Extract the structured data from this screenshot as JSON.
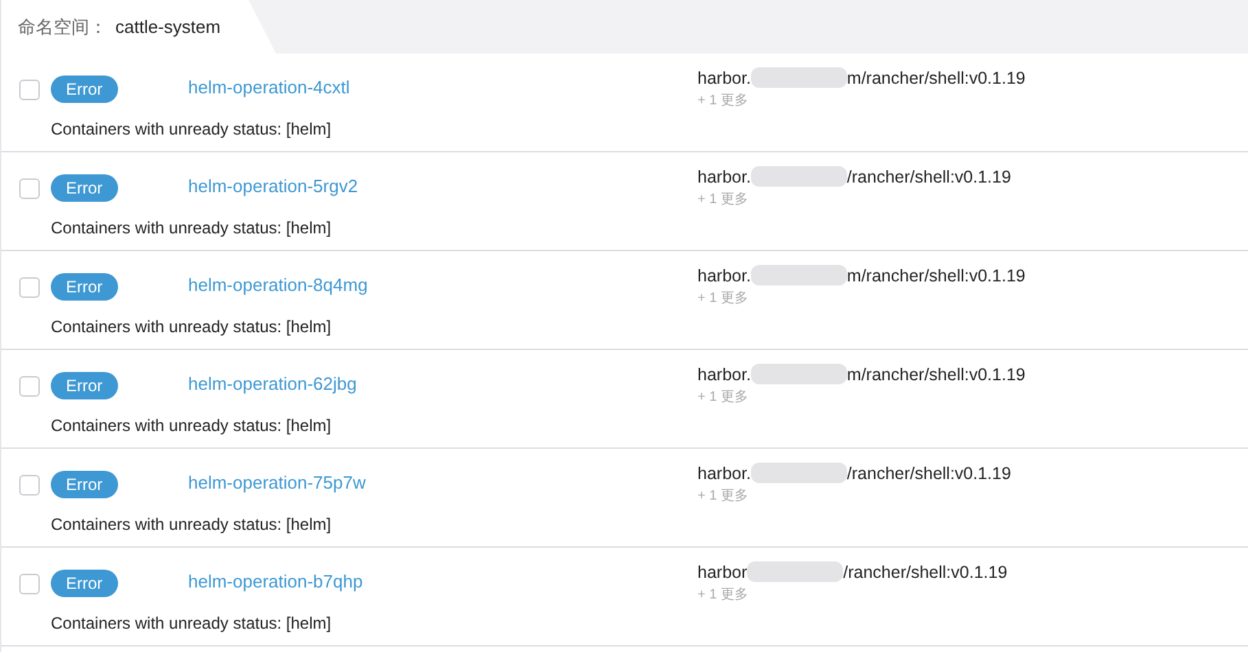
{
  "namespace": {
    "label": "命名空间：",
    "value": "cattle-system"
  },
  "rows": [
    {
      "checked": false,
      "status": "Error",
      "name": "helm-operation-4cxtl",
      "image_prefix": "harbor.",
      "image_suffix": "m/rancher/shell:v0.1.19",
      "more": "+ 1 更多",
      "message": "Containers with unready status: [helm]"
    },
    {
      "checked": false,
      "status": "Error",
      "name": "helm-operation-5rgv2",
      "image_prefix": "harbor.",
      "image_suffix": "/rancher/shell:v0.1.19",
      "more": "+ 1 更多",
      "message": "Containers with unready status: [helm]"
    },
    {
      "checked": false,
      "status": "Error",
      "name": "helm-operation-8q4mg",
      "image_prefix": "harbor.",
      "image_suffix": "m/rancher/shell:v0.1.19",
      "more": "+ 1 更多",
      "message": "Containers with unready status: [helm]"
    },
    {
      "checked": false,
      "status": "Error",
      "name": "helm-operation-62jbg",
      "image_prefix": "harbor.",
      "image_suffix": "m/rancher/shell:v0.1.19",
      "more": "+ 1 更多",
      "message": "Containers with unready status: [helm]"
    },
    {
      "checked": false,
      "status": "Error",
      "name": "helm-operation-75p7w",
      "image_prefix": "harbor.",
      "image_suffix": "/rancher/shell:v0.1.19",
      "more": "+ 1 更多",
      "message": "Containers with unready status: [helm]"
    },
    {
      "checked": false,
      "status": "Error",
      "name": "helm-operation-b7qhp",
      "image_prefix": "harbor",
      "image_suffix": "/rancher/shell:v0.1.19",
      "more": "+ 1 更多",
      "message": "Containers with unready status: [helm]"
    }
  ]
}
